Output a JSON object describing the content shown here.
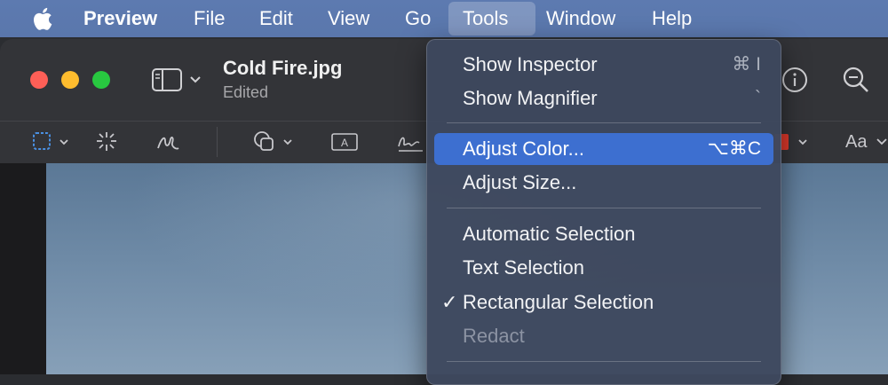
{
  "menubar": {
    "app_name": "Preview",
    "items": [
      "File",
      "Edit",
      "View",
      "Go",
      "Tools",
      "Window",
      "Help"
    ],
    "active_item": "Tools"
  },
  "window": {
    "title": "Cold Fire.jpg",
    "subtitle": "Edited"
  },
  "toolbar": {
    "text_style_label": "Aa"
  },
  "tools_menu": {
    "items": [
      {
        "label": "Show Inspector",
        "shortcut": "⌘ I"
      },
      {
        "label": "Show Magnifier",
        "shortcut": "`"
      },
      {
        "label": "Adjust Color...",
        "shortcut": "⌥⌘C",
        "highlighted": true
      },
      {
        "label": "Adjust Size...",
        "shortcut": ""
      },
      {
        "label": "Automatic Selection",
        "shortcut": ""
      },
      {
        "label": "Text Selection",
        "shortcut": ""
      },
      {
        "label": "Rectangular Selection",
        "shortcut": "",
        "checked": true
      },
      {
        "label": "Redact",
        "shortcut": "",
        "disabled": true
      }
    ],
    "checkmark": "✓"
  },
  "colors": {
    "menubar": "#5b78ae",
    "highlight": "#3d6fd0",
    "selection_tool": "#4a90e2",
    "color_swatch": "#e0392b"
  }
}
